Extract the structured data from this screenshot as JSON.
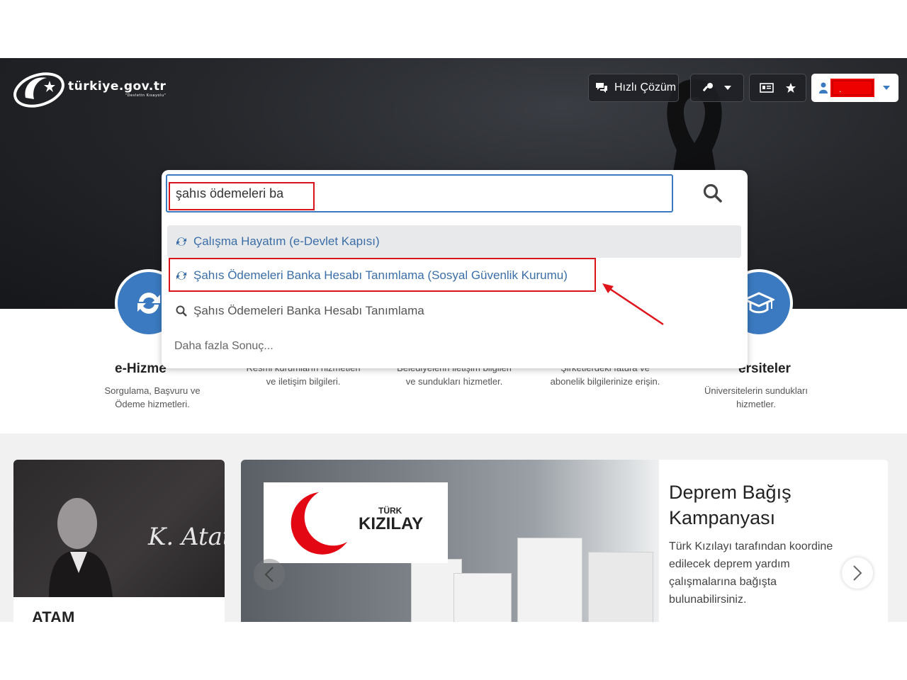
{
  "header": {
    "logo_text": "türkiye.gov.tr",
    "logo_sub": "\"Devletin Kısayolu\"",
    "quick_solution_label": "Hızlı Çözüm",
    "user_name": "."
  },
  "search": {
    "value": "şahıs ödemeleri ba",
    "suggestions": [
      {
        "label": "Çalışma Hayatım (e-Devlet Kapısı)",
        "icon": "refresh-icon"
      },
      {
        "label": "Şahıs Ödemeleri Banka Hesabı Tanımlama (Sosyal Güvenlik Kurumu)",
        "icon": "refresh-icon"
      },
      {
        "label": "Şahıs Ödemeleri Banka Hesabı Tanımlama",
        "icon": "search-icon"
      }
    ],
    "more_label": "Daha fazla Sonuç..."
  },
  "services": [
    {
      "title": "e-Hizme",
      "desc1": "Sorgulama, Başvuru ve",
      "desc2": "Ödeme hizmetleri."
    },
    {
      "title": "",
      "desc1": "Resmi kurumların hizmetleri",
      "desc2": "ve iletişim bilgileri."
    },
    {
      "title": "",
      "desc1": "Belediyelerin iletişim bilgileri",
      "desc2": "ve sundukları hizmetler."
    },
    {
      "title": "",
      "desc1": "Şirketlerdeki fatura ve",
      "desc2": "abonelik bilgilerinize erişin."
    },
    {
      "title": "ersiteler",
      "desc1": "Üniversitelerin sundukları",
      "desc2": "hizmetler."
    }
  ],
  "cards": {
    "atam_title": "ATAM",
    "signature": "K. Atatürk",
    "kizilay_brand_small": "TÜRK",
    "kizilay_brand_large": "KIZILAY",
    "box_label": "KIZILAY",
    "campaign_title": "Deprem Bağış Kampanyası",
    "campaign_text": "Türk Kızılayı tarafından koordine edilecek deprem yardım çalışmalarına bağışta bulunabilirsiniz."
  },
  "colors": {
    "accent": "#3b7ac0",
    "highlight": "#d9141b",
    "kizilay_red": "#e30613"
  }
}
